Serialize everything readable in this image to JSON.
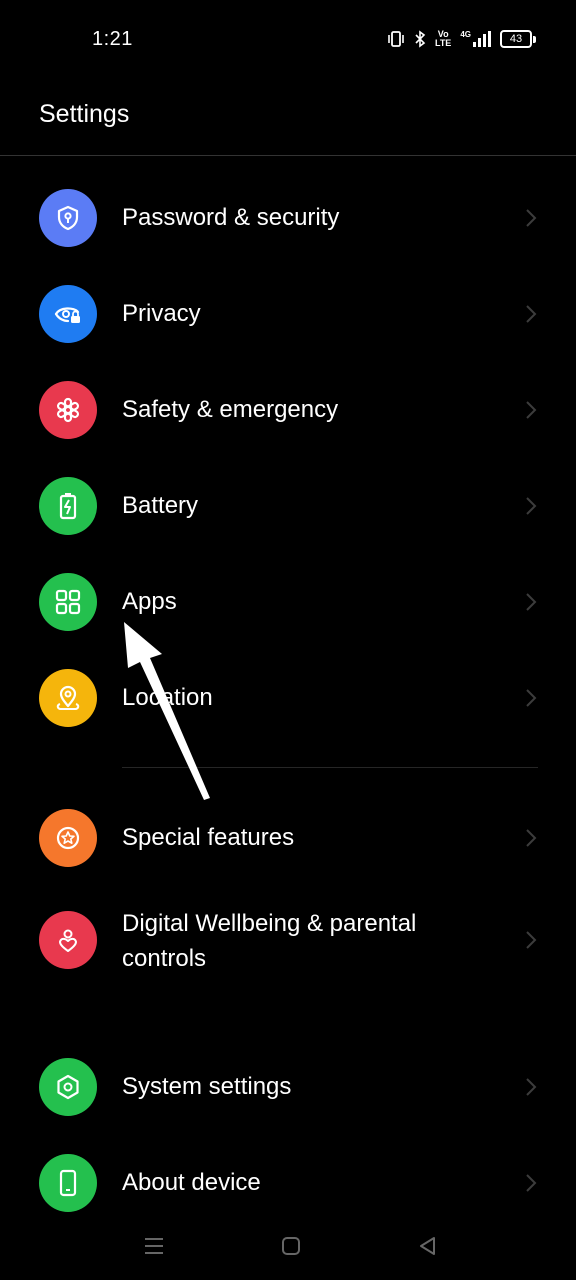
{
  "status_bar": {
    "time": "1:21",
    "volte_top": "Vo",
    "volte_bottom": "LTE",
    "network": "4G",
    "battery_level": "43"
  },
  "header": {
    "title": "Settings"
  },
  "settings": {
    "items": [
      {
        "label": "Password & security",
        "icon": "shield-lock-icon",
        "color": "#5b7cf5"
      },
      {
        "label": "Privacy",
        "icon": "eye-lock-icon",
        "color": "#1f7cf2"
      },
      {
        "label": "Safety & emergency",
        "icon": "asterisk-icon",
        "color": "#e8394e"
      },
      {
        "label": "Battery",
        "icon": "battery-icon",
        "color": "#24c04e"
      },
      {
        "label": "Apps",
        "icon": "apps-grid-icon",
        "color": "#24c04e"
      },
      {
        "label": "Location",
        "icon": "location-pin-icon",
        "color": "#f5b50c"
      },
      {
        "label": "Special features",
        "icon": "star-badge-icon",
        "color": "#f5772c"
      },
      {
        "label": "Digital Wellbeing & parental controls",
        "label_line1": "Digital Wellbeing & parental",
        "label_line2": "controls",
        "icon": "heart-person-icon",
        "color": "#e8394e"
      },
      {
        "label": "System settings",
        "icon": "hexagon-gear-icon",
        "color": "#24c04e"
      },
      {
        "label": "About device",
        "icon": "phone-device-icon",
        "color": "#24c04e"
      }
    ]
  },
  "nav_bar": {
    "buttons": [
      "menu-icon",
      "home-icon",
      "back-icon"
    ]
  }
}
